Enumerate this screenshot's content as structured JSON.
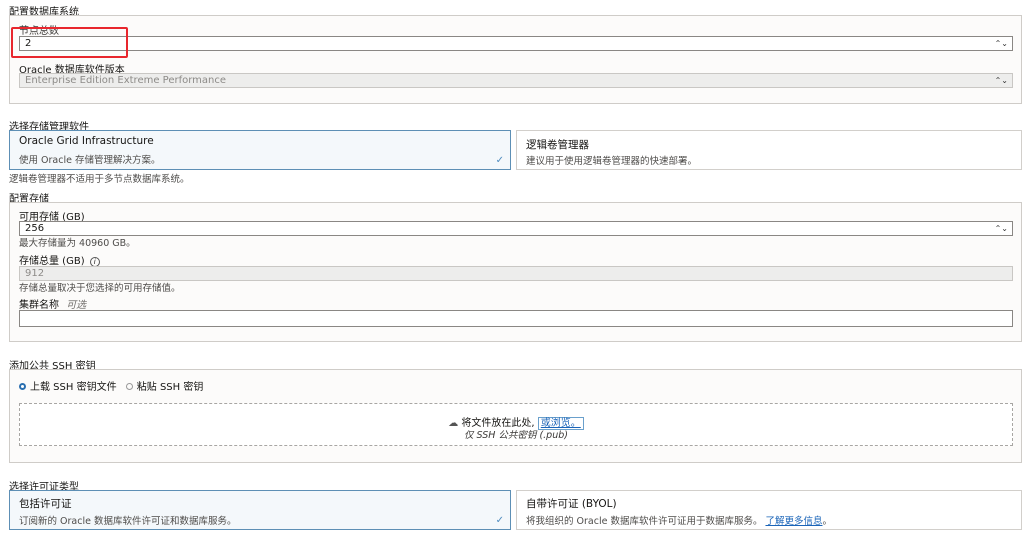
{
  "db_system": {
    "section_title": "配置数据库系统",
    "node_count_label": "节点总数",
    "node_count_value": "2",
    "db_version_label": "Oracle 数据库软件版本",
    "db_version_value": "Enterprise Edition Extreme Performance"
  },
  "storage_mgmt": {
    "section_title": "选择存储管理软件",
    "option_grid_title": "Oracle Grid Infrastructure",
    "option_grid_desc": "使用 Oracle 存储管理解决方案。",
    "option_lvm_title": "逻辑卷管理器",
    "option_lvm_desc": "建议用于使用逻辑卷管理器的快速部署。",
    "note": "逻辑卷管理器不适用于多节点数据库系统。",
    "selected": "grid"
  },
  "storage": {
    "section_title": "配置存储",
    "available_label": "可用存储 (GB)",
    "available_value": "256",
    "available_hint": "最大存储量为 40960 GB。",
    "total_label": "存储总量 (GB)",
    "total_value": "912",
    "total_hint": "存储总量取决于您选择的可用存储值。",
    "cluster_label": "集群名称",
    "cluster_optional": "可选",
    "cluster_value": ""
  },
  "ssh": {
    "section_title": "添加公共 SSH 密钥",
    "radio_upload": "上载 SSH 密钥文件",
    "radio_paste": "粘贴 SSH 密钥",
    "selected": "upload",
    "drop_text": "将文件放在此处,",
    "browse_link": "或浏览。",
    "drop_subtext": "仅 SSH 公共密钥 (.pub)"
  },
  "license": {
    "section_title": "选择许可证类型",
    "included_title": "包括许可证",
    "included_desc": "订阅新的 Oracle 数据库软件许可证和数据库服务。",
    "byol_title": "自带许可证 (BYOL)",
    "byol_desc": "将我组织的 Oracle 数据库软件许可证用于数据库服务。",
    "learn_more": "了解更多信息",
    "learn_more_suffix": "。",
    "selected": "included"
  },
  "colors": {
    "accent": "#4f8cbf",
    "link": "#1a64b8",
    "highlight": "#e8262d"
  }
}
